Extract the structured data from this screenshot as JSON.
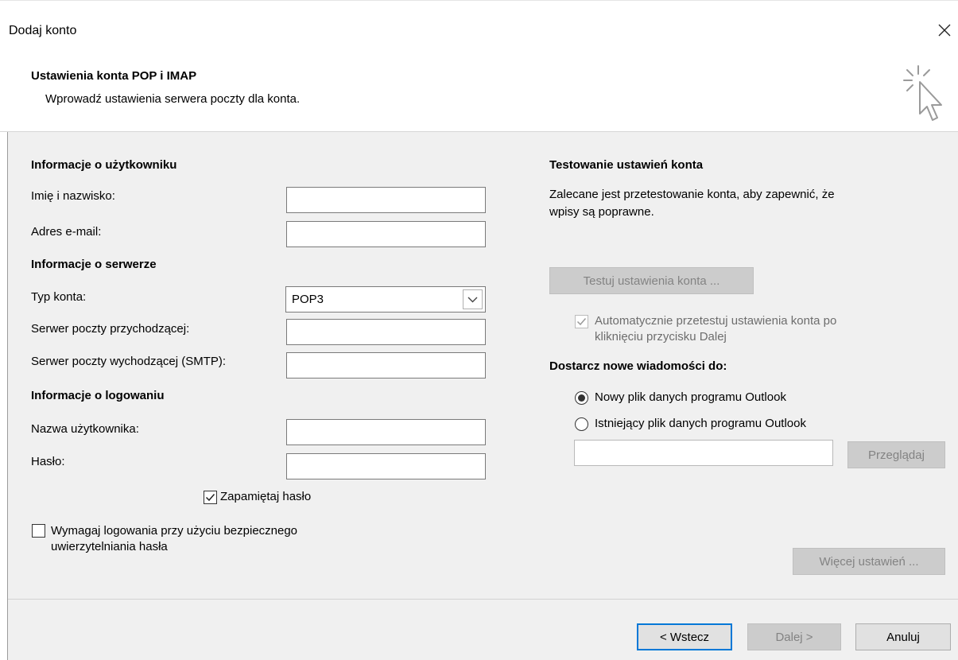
{
  "window": {
    "title": "Dodaj konto"
  },
  "header": {
    "title": "Ustawienia konta POP i IMAP",
    "subtitle": "Wprowadź ustawienia serwera poczty dla konta.",
    "icon": "cursor-click-icon"
  },
  "user_info": {
    "section_title": "Informacje o użytkowniku",
    "name_label": "Imię i nazwisko:",
    "name_value": "",
    "email_label": "Adres e-mail:",
    "email_value": ""
  },
  "server_info": {
    "section_title": "Informacje o serwerze",
    "account_type_label": "Typ konta:",
    "account_type_value": "POP3",
    "incoming_label": "Serwer poczty przychodzącej:",
    "incoming_value": "",
    "outgoing_label": "Serwer poczty wychodzącej (SMTP):",
    "outgoing_value": ""
  },
  "login_info": {
    "section_title": "Informacje o logowaniu",
    "username_label": "Nazwa użytkownika:",
    "username_value": "",
    "password_label": "Hasło:",
    "password_value": "",
    "remember_label": "Zapamiętaj hasło",
    "remember_checked": true,
    "spa_label_line1": "Wymagaj logowania przy użyciu bezpiecznego",
    "spa_label_line2": "uwierzytelniania hasła",
    "spa_checked": false
  },
  "test": {
    "section_title": "Testowanie ustawień konta",
    "desc_line1": "Zalecane jest przetestowanie konta, aby zapewnić, że",
    "desc_line2": "wpisy są poprawne.",
    "test_button": "Testuj ustawienia konta ...",
    "auto_test_line1": "Automatycznie przetestuj ustawienia konta po",
    "auto_test_line2": "kliknięciu przycisku Dalej",
    "auto_test_checked": true
  },
  "delivery": {
    "section_title": "Dostarcz nowe wiadomości do:",
    "option_new": "Nowy plik danych programu Outlook",
    "option_existing": "Istniejący plik danych programu Outlook",
    "selected": "new",
    "existing_path": "",
    "browse_button": "Przeglądaj"
  },
  "more_settings_button": "Więcej ustawień ...",
  "footer": {
    "back_button": "< Wstecz",
    "next_button": "Dalej >",
    "cancel_button": "Anuluj"
  },
  "colors": {
    "dialog_bg": "#f0f0f0",
    "accent": "#0078d7",
    "disabled_text": "#838383"
  }
}
